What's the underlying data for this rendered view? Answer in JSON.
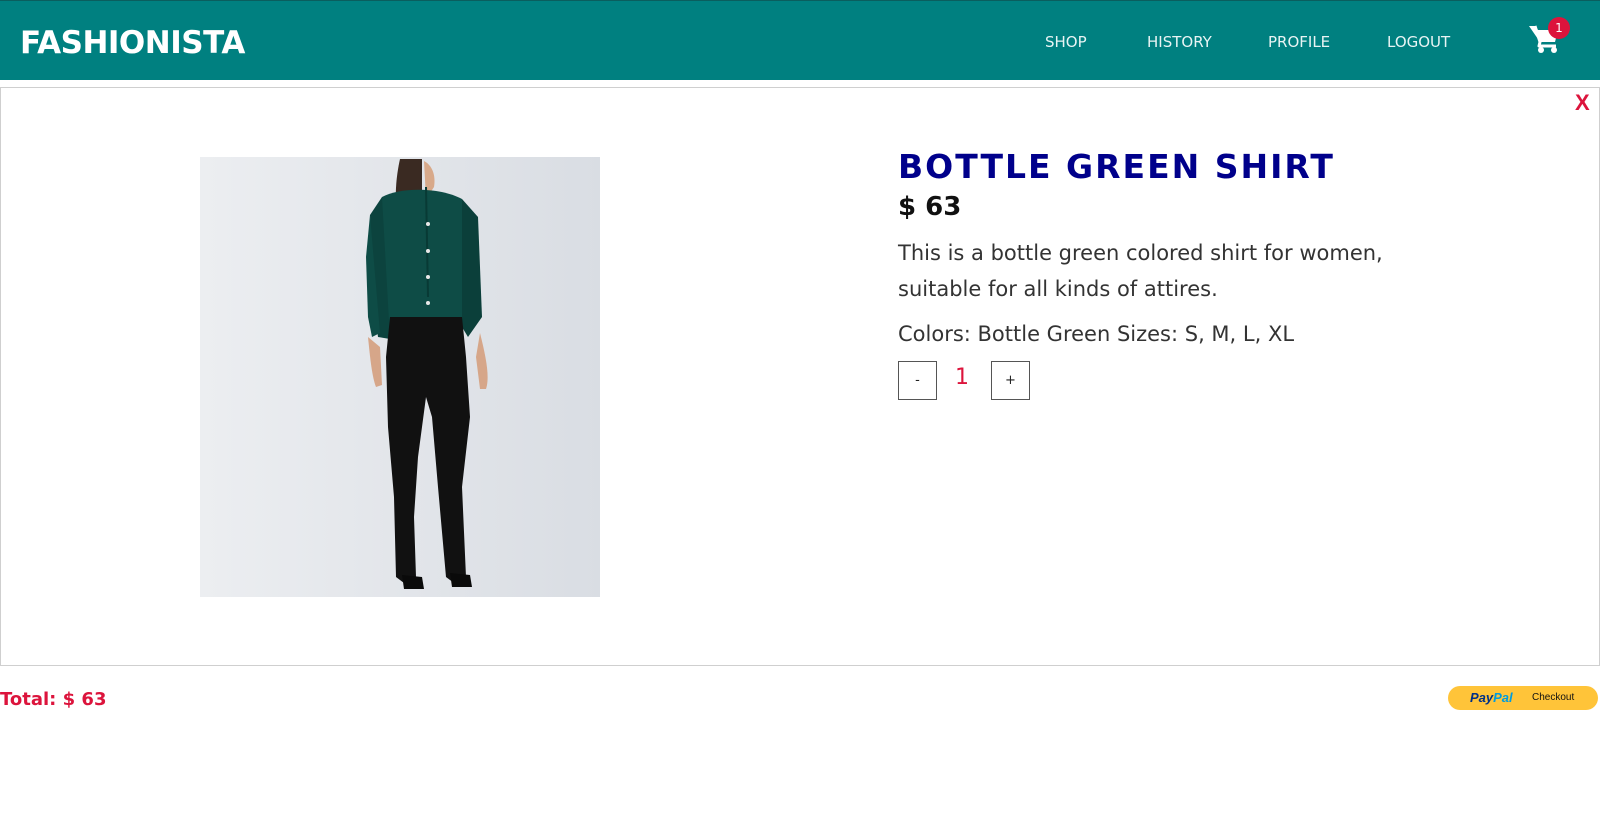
{
  "navbar": {
    "brand": "FASHIONISTA",
    "links": [
      "SHOP",
      "HISTORY",
      "PROFILE",
      "LOGOUT"
    ],
    "cart_count": "1",
    "bg_color": "#008080"
  },
  "modal": {
    "close_label": "X",
    "product": {
      "title": "BOTTLE GREEN SHIRT",
      "price": "$ 63",
      "description": "This is a bottle green colored shirt for women, suitable for all kinds of attires.",
      "meta": "Colors: Bottle Green Sizes: S, M, L, XL"
    },
    "quantity": {
      "minus_label": "-",
      "value": "1",
      "plus_label": "+"
    }
  },
  "footer": {
    "total": "Total: $ 63",
    "paypal": {
      "brand_pay": "Pay",
      "brand_pal": "Pal",
      "label": "Checkout"
    }
  },
  "colors": {
    "accent": "#dc143c",
    "title": "#00008b",
    "paypal": "#ffc439"
  }
}
